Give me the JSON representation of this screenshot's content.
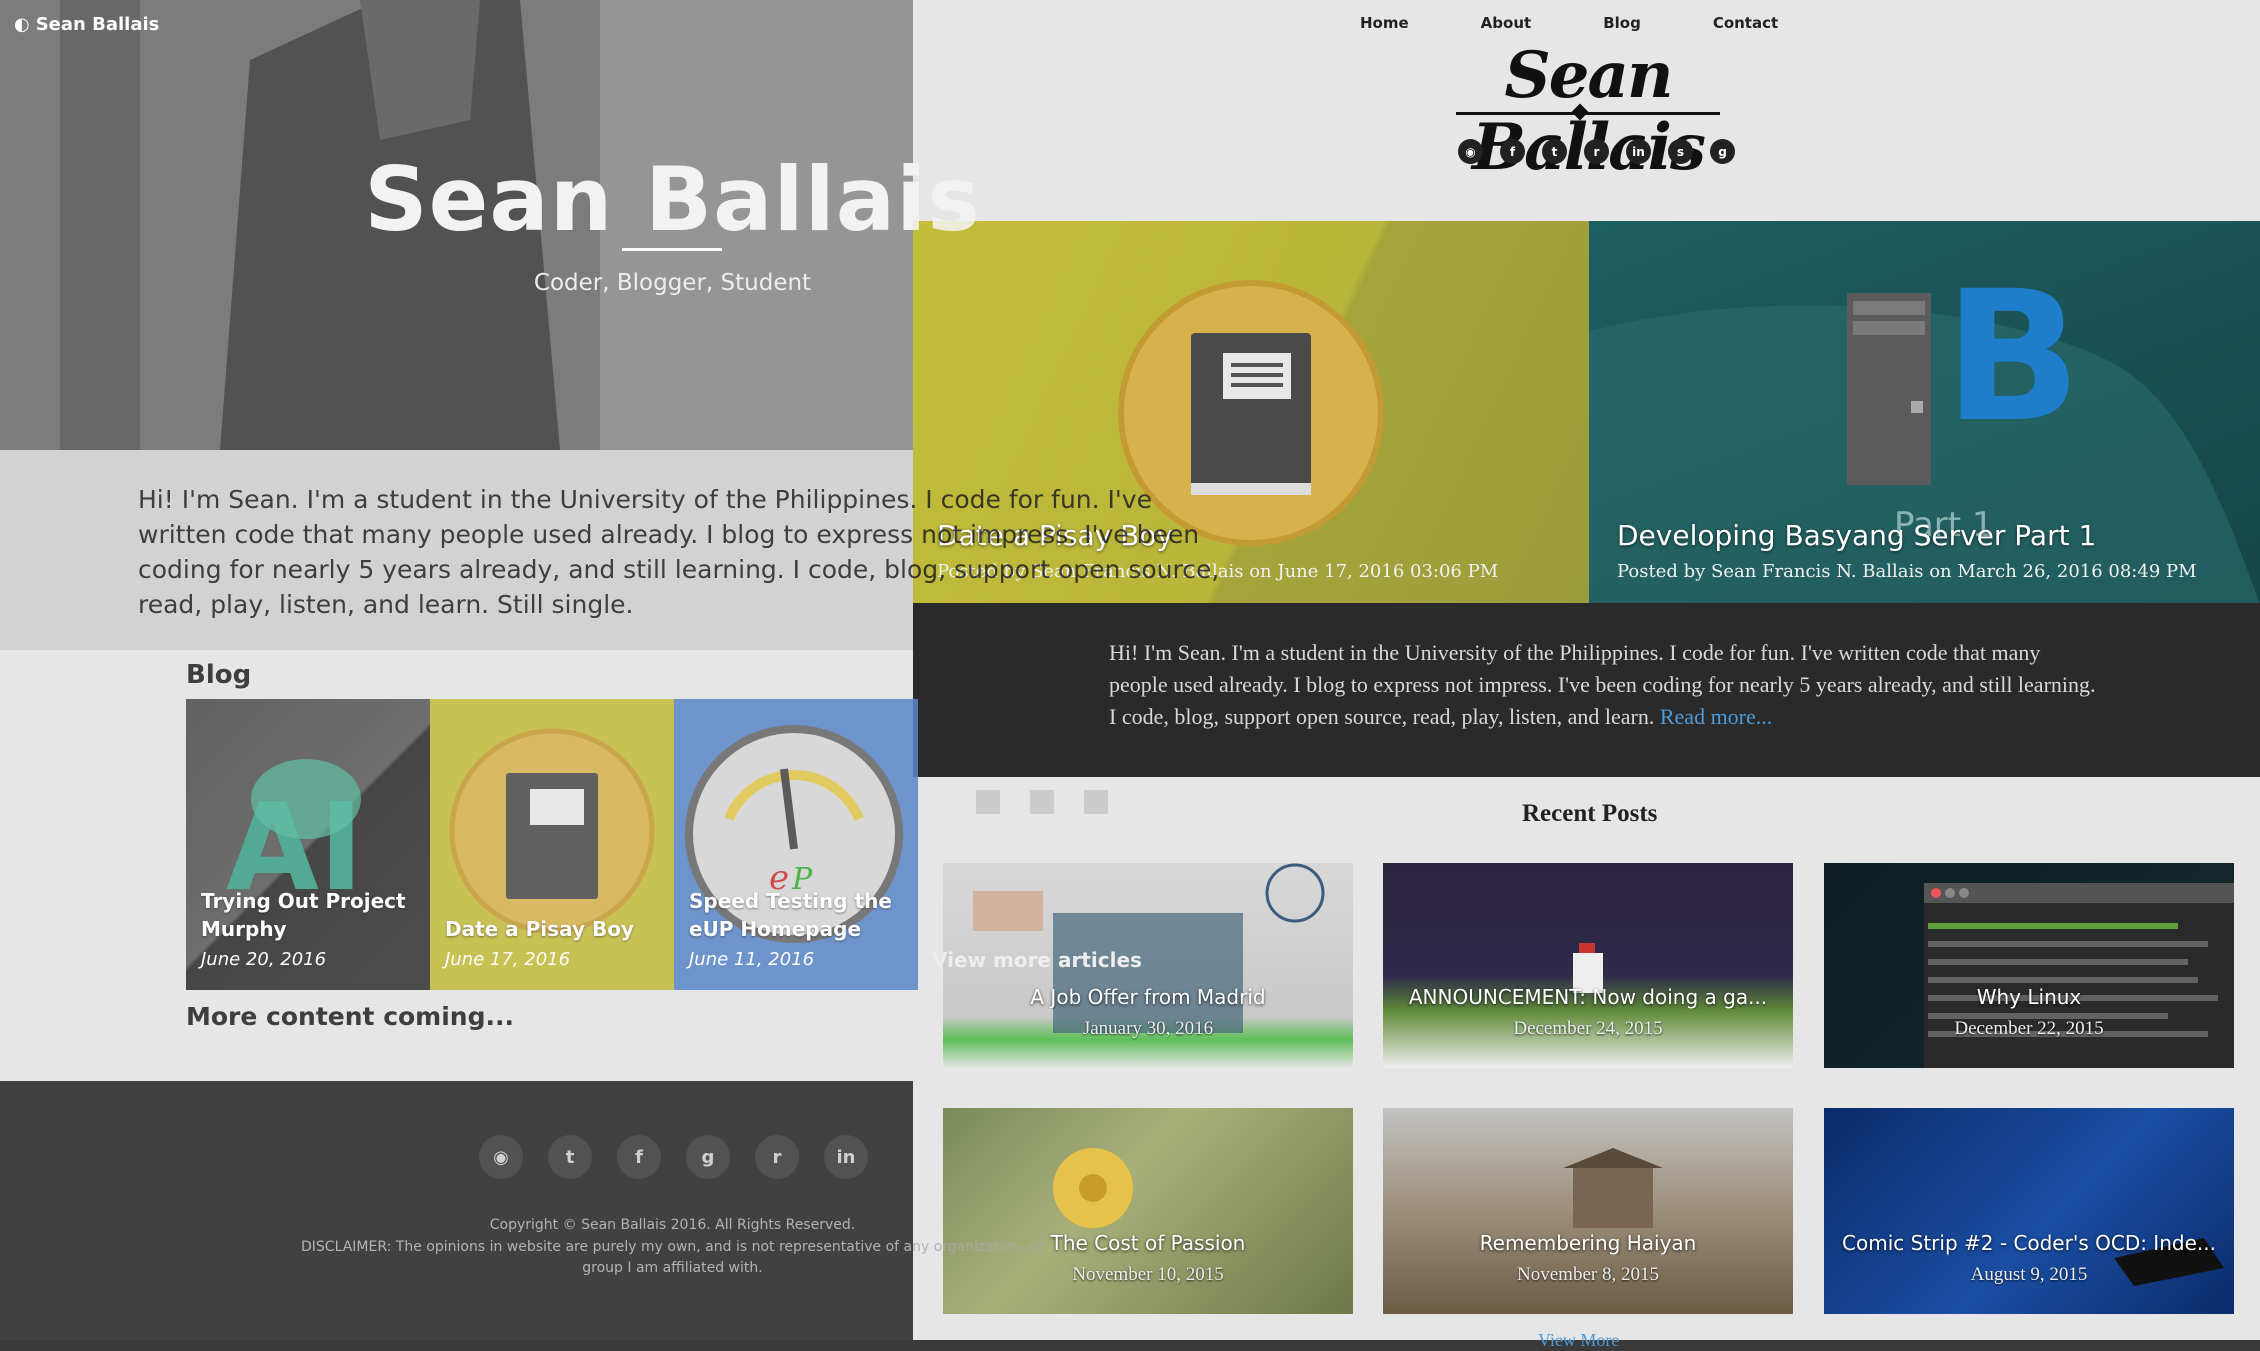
{
  "nav": [
    "Home",
    "About",
    "Blog",
    "Contact"
  ],
  "brand": "Sean Ballais",
  "social_icons": [
    "rss-icon",
    "facebook-icon",
    "twitter-icon",
    "reddit-icon",
    "linkedin-icon",
    "stackoverflow-icon",
    "github-icon"
  ],
  "featured": [
    {
      "title": "Date a Pisay Boy",
      "meta": "Posted by Sean Francis N. Ballais on June 17, 2016 03:06 PM"
    },
    {
      "title": "Developing Basyang Server Part 1",
      "meta": "Posted by Sean Francis N. Ballais on March 26, 2016 08:49 PM",
      "overlay": "Part 1"
    }
  ],
  "intro": {
    "text": "Hi! I'm Sean. I'm a student in the University of the Philippines. I code for fun. I've written code that many people used already. I blog to express not impress. I've been coding for nearly 5 years already, and still learning. I code, blog, support open source, read, play, listen, and learn.",
    "read_more": "Read more..."
  },
  "recent_heading": "Recent Posts",
  "recent_posts": [
    {
      "title": "A Job Offer from Madrid",
      "date": "January 30, 2016"
    },
    {
      "title": "ANNOUNCEMENT: Now doing a ga...",
      "date": "December 24, 2015"
    },
    {
      "title": "Why Linux",
      "date": "December 22, 2015"
    },
    {
      "title": "The Cost of Passion",
      "date": "November 10, 2015"
    },
    {
      "title": "Remembering Haiyan",
      "date": "November 8, 2015"
    },
    {
      "title": "Comic Strip #2 - Coder's OCD: Inde...",
      "date": "August 9, 2015"
    }
  ],
  "view_more_bottom": "View More",
  "old_site": {
    "brand": "Sean Ballais",
    "hero_title": "Sean Ballais",
    "hero_subtitle": "Coder, Blogger, Student",
    "bio": "Hi! I'm Sean. I'm a student in the University of the Philippines. I code for fun. I've written code that many people used already. I blog to express not impress. I've been coding for nearly 5 years already, and still learning. I code, blog, support open source, read, play, listen, and learn. Still single.",
    "blog_heading": "Blog",
    "blog_tiles": [
      {
        "title": "Trying Out Project Murphy",
        "date": "June 20, 2016"
      },
      {
        "title": "Date a Pisay Boy",
        "date": "June 17, 2016"
      },
      {
        "title": "Speed Testing the eUP Homepage",
        "date": "June 11, 2016"
      }
    ],
    "more_coming": "More content coming...",
    "view_more": "View more articles",
    "footer_icons": [
      "rss-icon",
      "twitter-icon",
      "facebook-icon",
      "github-icon",
      "reddit-icon",
      "linkedin-icon"
    ],
    "copyright": "Copyright © Sean Ballais 2016. All Rights Reserved.",
    "disclaimer": "DISCLAIMER: The opinions in website are purely my own, and is not representative of any organization, or group I am affiliated with."
  },
  "colors": {
    "accent_link": "#4d9bd8",
    "dark_band": "#2a2a2a",
    "footer": "#262626"
  }
}
